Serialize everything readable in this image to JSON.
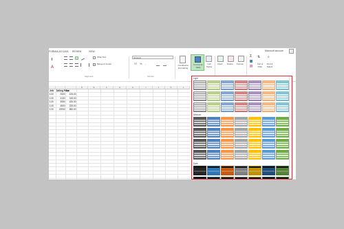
{
  "ribbon_tabs": [
    "FORMULAS",
    "DATA",
    "REVIEW",
    "VIEW"
  ],
  "account": "Microsoft account",
  "ribbon": {
    "wrap_text": "Wrap Text",
    "merge_center": "Merge & Center",
    "number_format": "General",
    "conditional": [
      "Conditional",
      "Formatting"
    ],
    "format_as": [
      "Format as",
      "Table"
    ],
    "cell_styles": [
      "Cell",
      "Styles"
    ],
    "insert": "Insert",
    "delete": "Delete",
    "format": "Format",
    "sort_filter": [
      "Sort &",
      "Filter"
    ],
    "find_select": [
      "Find &",
      "Select"
    ],
    "group_alignment": "Alignment",
    "group_number": "Number"
  },
  "columns": [
    "",
    "",
    "",
    "D",
    "E",
    "F",
    "G",
    "H",
    "I",
    "J",
    "K",
    "L"
  ],
  "rows": [
    [
      "Unit",
      "Selling Price",
      "Tax"
    ],
    [
      "5.00",
      "2500",
      "125.00"
    ],
    [
      "5.00",
      "3150",
      "315.00"
    ],
    [
      "5.00",
      "3550",
      "426.00"
    ],
    [
      "5.00",
      "4500",
      "225.00"
    ],
    [
      "5.00",
      "19900",
      "850.00"
    ]
  ],
  "gallery": {
    "sections": [
      "Light",
      "Medium",
      "Dark"
    ],
    "light_colors": [
      "#ffffff",
      "#9bbb59",
      "#4f81bd",
      "#c0504d",
      "#8064a2",
      "#f79646",
      "#4bacc6"
    ],
    "medium_colors": [
      "#555555",
      "#4f81bd",
      "#f79646",
      "#a5a5a5",
      "#ffc000",
      "#5b9bd5",
      "#70ad47"
    ],
    "dark_colors": [
      "#262626",
      "#2e75b6",
      "#c55a11",
      "#7f7f7f",
      "#bf9000",
      "#1f4e79",
      "#548235"
    ]
  }
}
